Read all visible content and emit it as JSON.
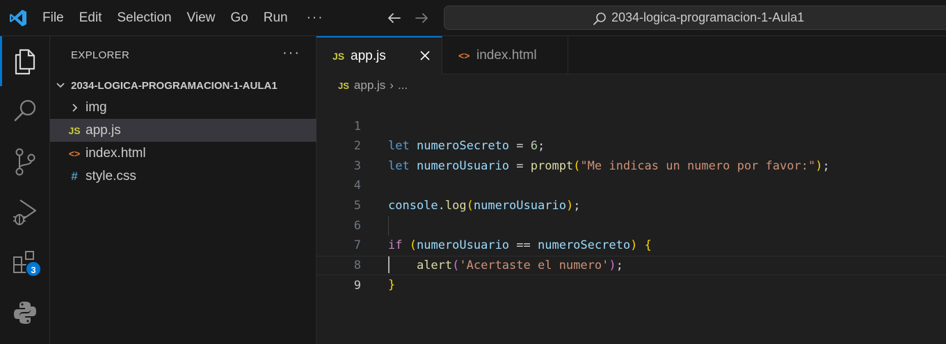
{
  "menu": {
    "items": [
      "File",
      "Edit",
      "Selection",
      "View",
      "Go",
      "Run"
    ],
    "more": "···"
  },
  "search": {
    "text": "2034-logica-programacion-1-Aula1"
  },
  "activity": {
    "extensions_badge": "3"
  },
  "explorer": {
    "title": "EXPLORER",
    "more": "···",
    "folder": "2034-LOGICA-PROGRAMACION-1-AULA1",
    "items": [
      {
        "icon": "›",
        "label": "img"
      },
      {
        "icon": "JS",
        "label": "app.js"
      },
      {
        "icon": "<>",
        "label": "index.html"
      },
      {
        "icon": "#",
        "label": "style.css"
      }
    ]
  },
  "tabs": [
    {
      "icon": "JS",
      "label": "app.js"
    },
    {
      "icon": "<>",
      "label": "index.html"
    }
  ],
  "breadcrumb": {
    "icon": "JS",
    "file": "app.js",
    "sep": "›",
    "rest": "..."
  },
  "editor": {
    "line_numbers": [
      "1",
      "2",
      "3",
      "4",
      "5",
      "6",
      "7",
      "8",
      "9"
    ],
    "code": {
      "l1": {
        "kw": "let",
        "var": "numeroSecreto",
        "op": " = ",
        "num": "6",
        "end": ";"
      },
      "l2": {
        "kw": "let",
        "var": "numeroUsuario",
        "op": " = ",
        "fn": "prompt",
        "open": "(",
        "str": "\"Me indicas un numero por favor:\"",
        "close": ")",
        "end": ";"
      },
      "l4": {
        "obj": "console",
        "dot": ".",
        "fn": "log",
        "open": "(",
        "arg": "numeroUsuario",
        "close": ")",
        "end": ";"
      },
      "l6": {
        "kw": "if",
        "open": "(",
        "a": "numeroUsuario",
        "op": " == ",
        "b": "numeroSecreto",
        "close": ")",
        "brace": "{"
      },
      "l7": {
        "fn": "alert",
        "open": "(",
        "str": "'Acertaste el numero'",
        "close": ")",
        "end": ";"
      },
      "l8": {
        "brace": "}"
      }
    }
  },
  "colors": {
    "accent": "#0078d4",
    "js_icon": "#cbcb41",
    "html_icon": "#e37933",
    "css_icon": "#519aba"
  }
}
